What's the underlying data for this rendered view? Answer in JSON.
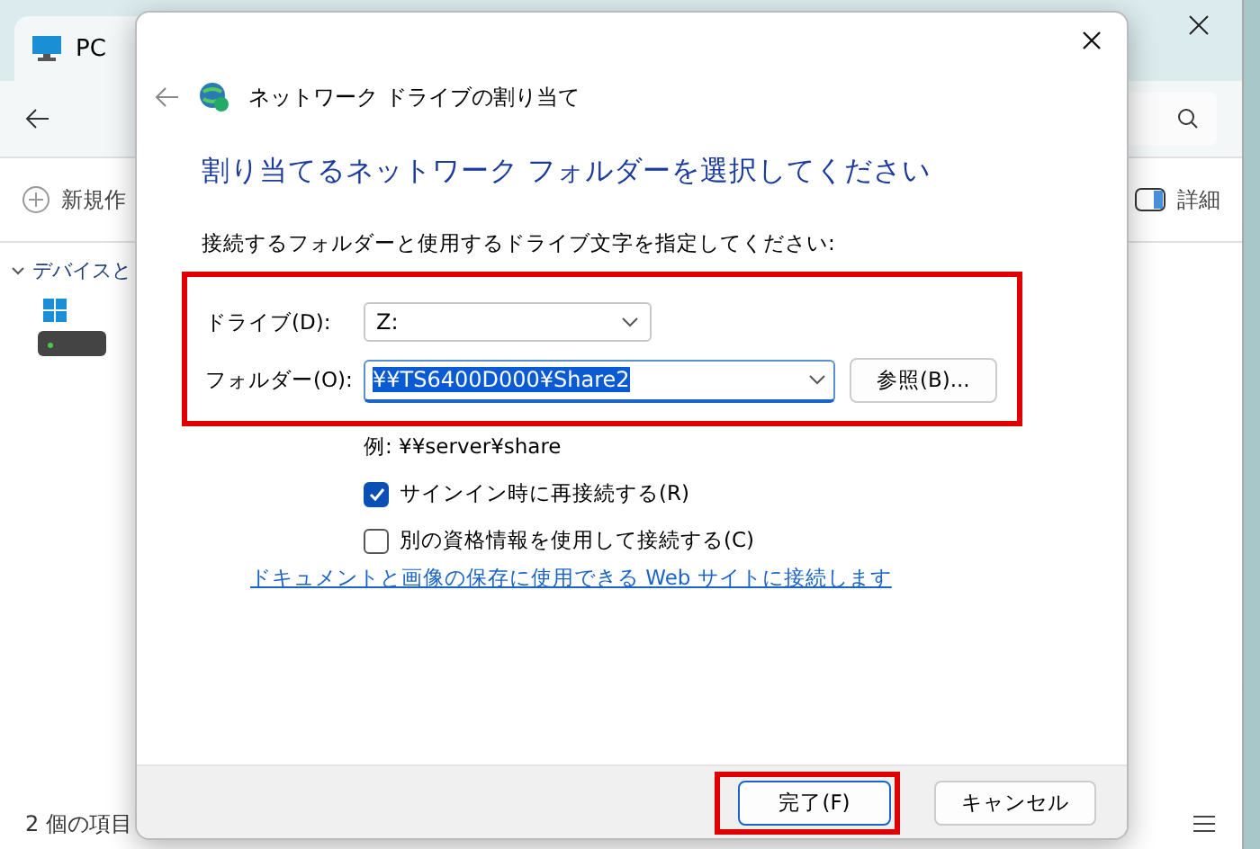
{
  "explorer": {
    "title": "PC",
    "toolbar": {
      "new_button": "新規作",
      "details_button": "詳細"
    },
    "sidebar": {
      "section": "デバイスと"
    },
    "status_bar": "2 個の項目"
  },
  "dialog": {
    "title": "ネットワーク ドライブの割り当て",
    "heading": "割り当てるネットワーク フォルダーを選択してください",
    "instruction": "接続するフォルダーと使用するドライブ文字を指定してください:",
    "form": {
      "highlighted": true,
      "drive_label": "ドライブ(D):",
      "drive_value": "Z:",
      "folder_label": "フォルダー(O):",
      "folder_value": "¥¥TS6400D000¥Share2",
      "folder_value_selected": true,
      "browse_button": "参照(B)..."
    },
    "example": "例: ¥¥server¥share",
    "options": [
      {
        "label": "サインイン時に再接続する(R)",
        "checked": true
      },
      {
        "label": "別の資格情報を使用して接続する(C)",
        "checked": false
      }
    ],
    "link": "ドキュメントと画像の保存に使用できる Web サイトに接続します",
    "buttons": [
      {
        "label": "完了(F)",
        "default": true,
        "highlighted": true
      },
      {
        "label": "キャンセル",
        "default": false,
        "highlighted": false
      }
    ]
  }
}
